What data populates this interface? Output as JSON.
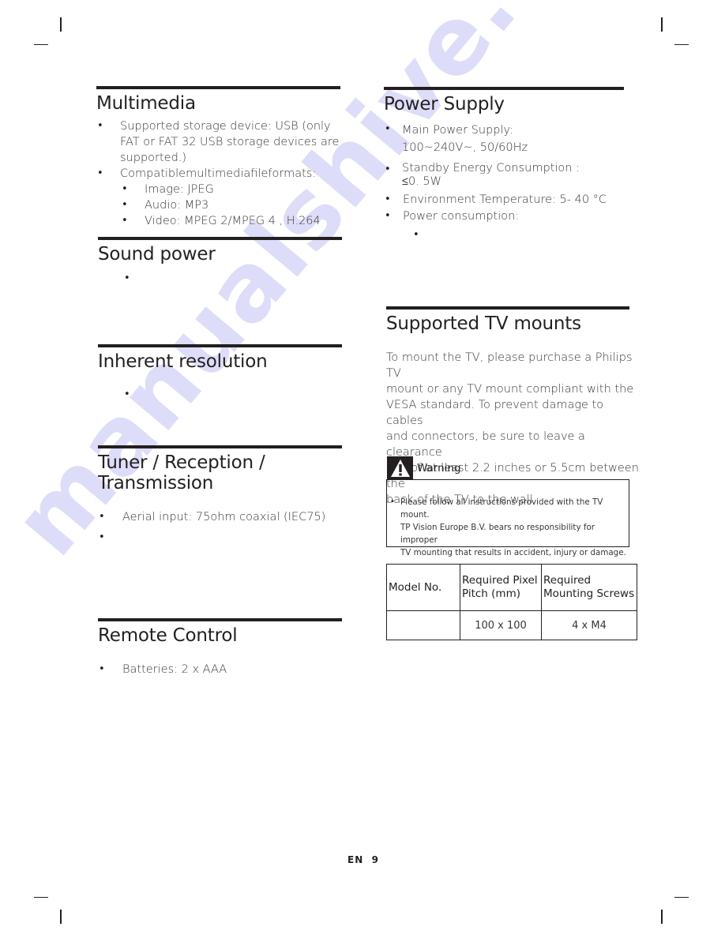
{
  "watermark": "manualshive.com",
  "left_column": {
    "multimedia": {
      "title": "Multimedia",
      "items": [
        {
          "lines": [
            "Supported storage device: USB (only",
            "FAT or FAT 32 USB storage devices are",
            "supported.)"
          ]
        },
        {
          "lines": [
            "Compatiblemultimediafileformats:"
          ]
        }
      ],
      "sub_items": [
        "Image: JPEG",
        "Audio: MP3",
        "Video: MPEG 2/MPEG 4 , H.264"
      ]
    },
    "sound_power": {
      "title": "Sound power",
      "items": [
        ""
      ]
    },
    "inherent_resolution": {
      "title": "Inherent resolution",
      "items": [
        ""
      ]
    },
    "tuner": {
      "title_line1": "Tuner / Reception /",
      "title_line2": "Transmission",
      "items": [
        "Aerial input: 75ohm coaxial (IEC75)",
        ""
      ]
    },
    "remote_control": {
      "title": "Remote Control",
      "items": [
        "Batteries: 2 x AAA"
      ]
    }
  },
  "right_column": {
    "power_supply": {
      "title": "Power Supply",
      "items": [
        {
          "lines": [
            "Main  Power Supply:",
            "100~240V~, 50/60Hz"
          ]
        },
        {
          "lines": [
            "Standby  Energy  Consumption :",
            "≤0. 5W"
          ]
        },
        {
          "lines": [
            "Environment  Temperature:  5- 40 °C"
          ]
        },
        {
          "lines": [
            "Power consumption:"
          ]
        }
      ],
      "sub_items": [
        ""
      ]
    },
    "tv_mounts": {
      "title": "Supported TV mounts",
      "paragraph_lines": [
        "To mount the TV, please purchase a Philips TV",
        "mount or any TV mount compliant with the",
        "VESA standard. To prevent damage to cables",
        "and connectors, be sure to leave a clearance",
        "gap of at least 2.2 inches or 5.5cm between the",
        "back of the TV to the wall."
      ],
      "warning": {
        "label": "Warning",
        "icon": "warning-triangle-icon",
        "lines": [
          "Please follow all instructions provided with the TV mount.",
          "TP Vision Europe B.V. bears no responsibility for improper",
          "TV mounting that results in accident, injury or damage."
        ]
      },
      "table": {
        "headers": [
          [
            "Model No."
          ],
          [
            "Required Pixel",
            "Pitch (mm)"
          ],
          [
            "Required",
            "Mounting Screws"
          ]
        ],
        "rows": [
          [
            "",
            "100 x 100",
            "4 x M4"
          ]
        ]
      }
    }
  },
  "footer": {
    "lang": "EN",
    "page": "9"
  }
}
